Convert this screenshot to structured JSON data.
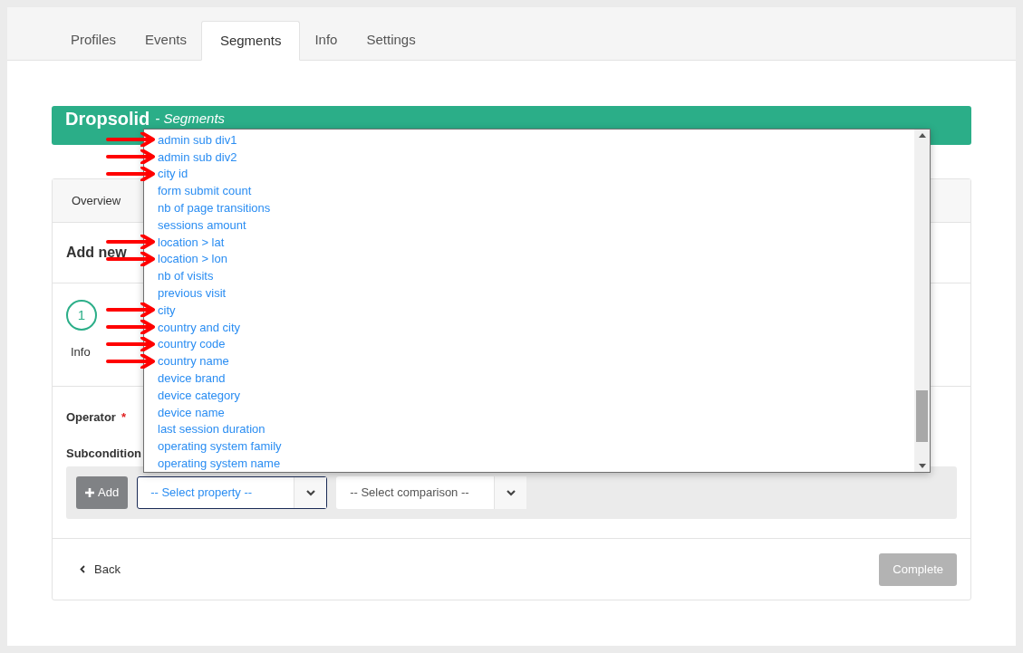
{
  "tabs": [
    {
      "label": "Profiles",
      "selected": false
    },
    {
      "label": "Events",
      "selected": false
    },
    {
      "label": "Segments",
      "selected": true
    },
    {
      "label": "Info",
      "selected": false
    },
    {
      "label": "Settings",
      "selected": false
    }
  ],
  "header": {
    "title": "Dropsolid",
    "subtitle": "- Segments"
  },
  "panel_tab": "Overview",
  "section_title": "Add new",
  "step": {
    "number": "1",
    "label": "Info"
  },
  "operator_label": "Operator",
  "required_mark": "*",
  "subcondition_label": "Subcondition",
  "add_button": "Add",
  "property_select": {
    "placeholder": "-- Select property --"
  },
  "comparison_select": {
    "placeholder": "-- Select comparison --"
  },
  "dropdown_items": [
    {
      "label": "admin sub div1",
      "marked": true
    },
    {
      "label": "admin sub div2",
      "marked": true
    },
    {
      "label": "city id",
      "marked": true
    },
    {
      "label": "form submit count",
      "marked": false
    },
    {
      "label": "nb of page transitions",
      "marked": false
    },
    {
      "label": "sessions amount",
      "marked": false
    },
    {
      "label": "location > lat",
      "marked": true
    },
    {
      "label": "location > lon",
      "marked": true
    },
    {
      "label": "nb of visits",
      "marked": false
    },
    {
      "label": "previous visit",
      "marked": false
    },
    {
      "label": "city",
      "marked": true
    },
    {
      "label": "country and city",
      "marked": true
    },
    {
      "label": "country code",
      "marked": true
    },
    {
      "label": "country name",
      "marked": true
    },
    {
      "label": "device brand",
      "marked": false
    },
    {
      "label": "device category",
      "marked": false
    },
    {
      "label": "device name",
      "marked": false
    },
    {
      "label": "last session duration",
      "marked": false
    },
    {
      "label": "operating system family",
      "marked": false
    },
    {
      "label": "operating system name",
      "marked": false
    }
  ],
  "back_button": "Back",
  "complete_button": "Complete"
}
